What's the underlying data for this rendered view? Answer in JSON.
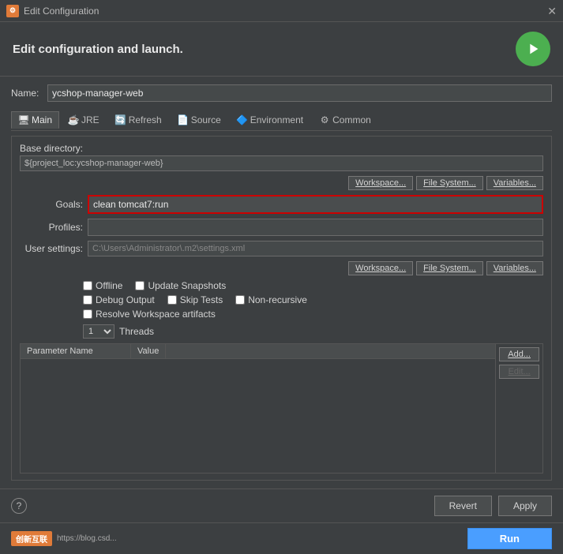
{
  "titleBar": {
    "icon": "⚙",
    "title": "Edit Configuration",
    "closeIcon": "✕"
  },
  "header": {
    "title": "Edit configuration and launch.",
    "goButton": "▶"
  },
  "nameRow": {
    "label": "Name:",
    "value": "ycshop-manager-web"
  },
  "tabs": [
    {
      "id": "main",
      "label": "Main",
      "icon": "🖥",
      "active": true
    },
    {
      "id": "jre",
      "label": "JRE",
      "icon": "☕"
    },
    {
      "id": "refresh",
      "label": "Refresh",
      "icon": "🔄"
    },
    {
      "id": "source",
      "label": "Source",
      "icon": "📄"
    },
    {
      "id": "environment",
      "label": "Environment",
      "icon": "🔷"
    },
    {
      "id": "common",
      "label": "Common",
      "icon": "⚙"
    }
  ],
  "panel": {
    "baseDir": {
      "label": "Base directory:",
      "value": "${project_loc:ycshop-manager-web}"
    },
    "btns1": [
      "Workspace...",
      "File System...",
      "Variables..."
    ],
    "goals": {
      "label": "Goals:",
      "value": "clean tomcat7:run"
    },
    "profiles": {
      "label": "Profiles:",
      "value": ""
    },
    "userSettings": {
      "label": "User settings:",
      "value": "C:\\Users\\Administrator\\.m2\\settings.xml"
    },
    "btns2": [
      "Workspace...",
      "File System...",
      "Variables..."
    ],
    "checkboxes": {
      "row1": [
        {
          "label": "Offline",
          "checked": false
        },
        {
          "label": "Update Snapshots",
          "checked": false
        }
      ],
      "row2": [
        {
          "label": "Debug Output",
          "checked": false
        },
        {
          "label": "Skip Tests",
          "checked": false
        },
        {
          "label": "Non-recursive",
          "checked": false
        }
      ],
      "row3": [
        {
          "label": "Resolve Workspace artifacts",
          "checked": false
        }
      ]
    },
    "threads": {
      "value": "1",
      "label": "Threads"
    },
    "table": {
      "columns": [
        "Parameter Name",
        "Value"
      ],
      "rows": [],
      "sideButtons": [
        "Add...",
        "Edit..."
      ]
    }
  },
  "bottomButtons": {
    "revert": "Revert",
    "apply": "Apply"
  },
  "runBar": {
    "runLabel": "Run",
    "watermarkBrand": "创新互联",
    "watermarkUrl": "https://blog.csd..."
  }
}
